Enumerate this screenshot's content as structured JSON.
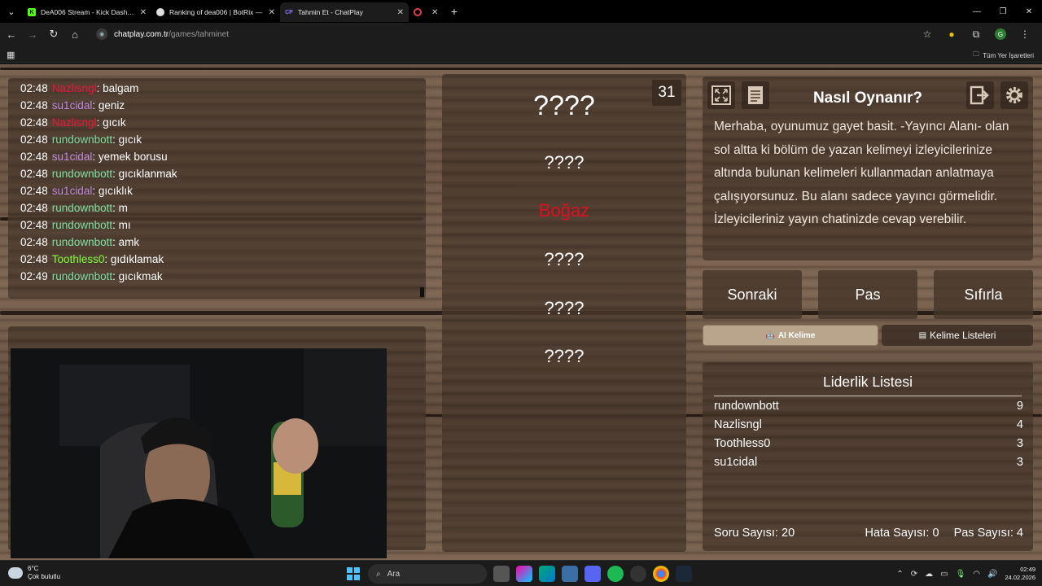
{
  "browser": {
    "tabs": [
      {
        "title": "DeA006 Stream - Kick Dashboa",
        "favicon": "kick-icon",
        "color": "#53fc18"
      },
      {
        "title": "Ranking of dea006 | BotRix — ",
        "favicon": "botrix-icon",
        "color": "#dddddd"
      },
      {
        "title": "Tahmin Et - ChatPlay",
        "favicon": "chatplay-icon",
        "color": "#6a5acd"
      },
      {
        "title": "",
        "favicon": "record-icon",
        "color": "#e04050"
      }
    ],
    "url_host": "chatplay.com.tr",
    "url_path": "/games/tahminet",
    "bookmarks_all": "Tüm Yer İşaretleri",
    "profile_initial": "G"
  },
  "chat": {
    "messages": [
      {
        "time": "02:48",
        "user": "Nazlisngl",
        "text": ": balgam",
        "color": "#e8173a"
      },
      {
        "time": "02:48",
        "user": "su1cidal",
        "text": ": geniz",
        "color": "#c08ae0"
      },
      {
        "time": "02:48",
        "user": "Nazlisngl",
        "text": ": gıcık",
        "color": "#e8173a"
      },
      {
        "time": "02:48",
        "user": "rundownbott",
        "text": ": gıcık",
        "color": "#7fe0a0"
      },
      {
        "time": "02:48",
        "user": "su1cidal",
        "text": ": yemek borusu",
        "color": "#c08ae0"
      },
      {
        "time": "02:48",
        "user": "rundownbott",
        "text": ": gıcıklanmak",
        "color": "#7fe0a0"
      },
      {
        "time": "02:48",
        "user": "su1cidal",
        "text": ": gıcıklık",
        "color": "#c08ae0"
      },
      {
        "time": "02:48",
        "user": "rundownbott",
        "text": ": m",
        "color": "#7fe0a0"
      },
      {
        "time": "02:48",
        "user": "rundownbott",
        "text": ": mı",
        "color": "#7fe0a0"
      },
      {
        "time": "02:48",
        "user": "rundownbott",
        "text": ": amk",
        "color": "#7fe0a0"
      },
      {
        "time": "02:48",
        "user": "Toothless0",
        "text": ": gıdıklamak",
        "color": "#7dff3a"
      },
      {
        "time": "02:49",
        "user": "rundownbott",
        "text": ": gıcıkmak",
        "color": "#7fe0a0"
      }
    ]
  },
  "game": {
    "timer": "31",
    "words": [
      {
        "text": "????",
        "size": "big",
        "color": "#ffffff"
      },
      {
        "text": "????",
        "size": "normal",
        "color": "#ffffff"
      },
      {
        "text": "Boğaz",
        "size": "normal",
        "color": "#e01020"
      },
      {
        "text": "????",
        "size": "normal",
        "color": "#ffffff"
      },
      {
        "text": "????",
        "size": "normal",
        "color": "#ffffff"
      },
      {
        "text": "????",
        "size": "normal",
        "color": "#ffffff"
      }
    ]
  },
  "howto": {
    "title": "Nasıl Oynanır?",
    "text": "Merhaba, oyunumuz gayet basit. -Yayıncı Alanı- olan sol altta ki bölüm de yazan kelimeyi izleyicilerinize altında bulunan kelimeleri kullanmadan anlatmaya çalışıyorsunuz. Bu alanı sadece yayıncı görmelidir. İzleyicileriniz yayın chatinizde cevap verebilir."
  },
  "controls": {
    "next": "Sonraki",
    "pass": "Pas",
    "reset": "Sıfırla",
    "ai_word": "AI Kelime",
    "word_lists": "Kelime Listeleri"
  },
  "leaderboard": {
    "title": "Liderlik Listesi",
    "rows": [
      {
        "name": "rundownbott",
        "score": "9"
      },
      {
        "name": "Nazlisngl",
        "score": "4"
      },
      {
        "name": "Toothless0",
        "score": "3"
      },
      {
        "name": "su1cidal",
        "score": "3"
      }
    ],
    "question_count": "Soru Sayısı: 20",
    "error_count": "Hata Sayısı: 0",
    "pass_count": "Pas Sayısı: 4"
  },
  "taskbar": {
    "temperature": "6°C",
    "weather": "Çok bulutlu",
    "search": "Ara",
    "time": "02:49",
    "date": "24.02.2026"
  }
}
